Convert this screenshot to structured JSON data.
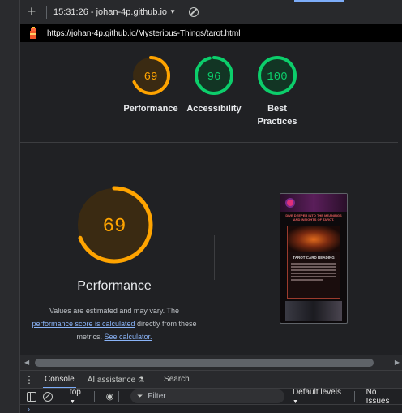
{
  "topbar": {
    "plus": "+",
    "report_title": "15:31:26 - johan-4p.github.io",
    "caret": "▼"
  },
  "urlbar": {
    "url": "https://johan-4p.github.io/Mysterious-Things/tarot.html"
  },
  "gauges": [
    {
      "score": "69",
      "value": 69,
      "label": "Performance",
      "color": "#ffa400",
      "bg": "#3a2a12"
    },
    {
      "score": "96",
      "value": 96,
      "label": "Accessibility",
      "color": "#0cce6b",
      "bg": "#123524"
    },
    {
      "score": "100",
      "value": 100,
      "label": "Best Practices",
      "color": "#0cce6b",
      "bg": "#123524"
    }
  ],
  "main": {
    "score": "69",
    "value": 69,
    "color": "#ffa400",
    "title": "Performance",
    "desc_1": "Values are estimated and may vary. The",
    "desc_link_1": "performance score is calculated",
    "desc_2": "directly from these metrics.",
    "desc_link_2": "See calculator."
  },
  "thumbnail": {
    "headline": "DIVE DEEPER INTO THE MEANINGS AND INSIGHTS OF TAROT.",
    "card_title": "TAROT CARD READING"
  },
  "drawer": {
    "tabs": [
      "Console",
      "AI assistance",
      "Search"
    ]
  },
  "console_toolbar": {
    "context": "top",
    "filter_placeholder": "Filter",
    "levels": "Default levels",
    "issues": "No Issues"
  },
  "prompt": "›"
}
